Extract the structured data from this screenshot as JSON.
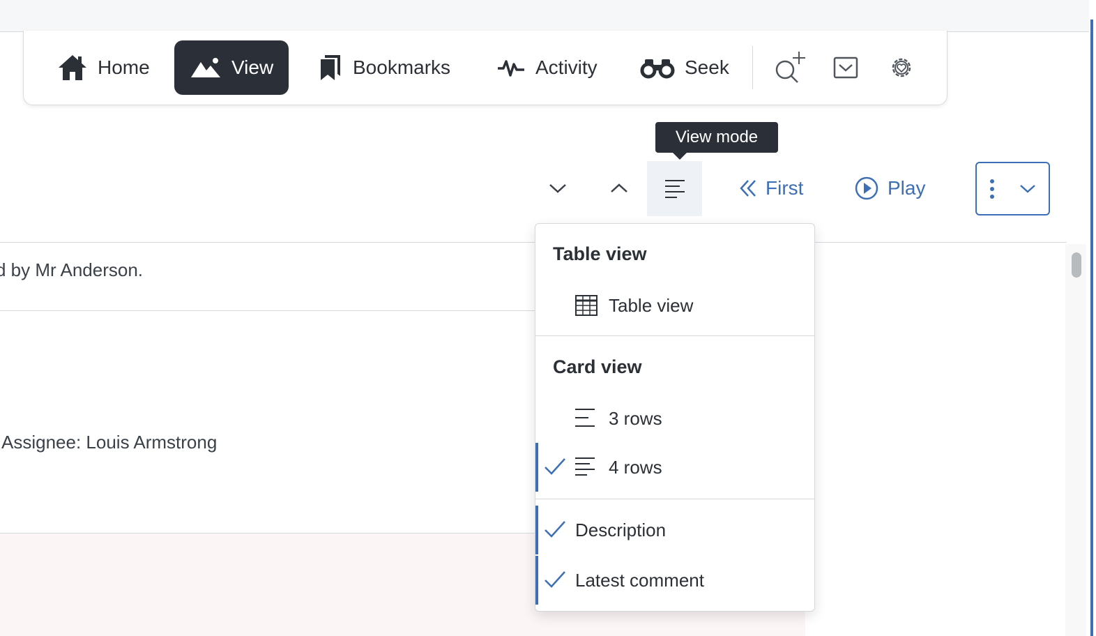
{
  "nav": {
    "items": [
      {
        "label": "Home",
        "icon": "home-icon"
      },
      {
        "label": "View",
        "icon": "mountain-icon",
        "active": true
      },
      {
        "label": "Bookmarks",
        "icon": "bookmarks-icon"
      },
      {
        "label": "Activity",
        "icon": "activity-icon"
      },
      {
        "label": "Seek",
        "icon": "binoculars-icon"
      }
    ],
    "icon_buttons": [
      "search-plus-icon",
      "inbox-icon",
      "gear-heart-icon"
    ]
  },
  "toolbar": {
    "tooltip": "View mode",
    "first_label": "First",
    "play_label": "Play"
  },
  "content": {
    "row1_text": "d by Mr Anderson.",
    "row2_assignee_label": "Assignee:",
    "row2_assignee_value": "Louis Armstrong"
  },
  "menu": {
    "table_header": "Table view",
    "table_item": "Table view",
    "card_header": "Card view",
    "card_items": [
      {
        "label": "3 rows",
        "checked": false
      },
      {
        "label": "4 rows",
        "checked": true
      }
    ],
    "extra_items": [
      {
        "label": "Description",
        "checked": true
      },
      {
        "label": "Latest comment",
        "checked": true
      }
    ]
  },
  "colors": {
    "accent": "#3d6fb6",
    "dark": "#2b3038"
  }
}
